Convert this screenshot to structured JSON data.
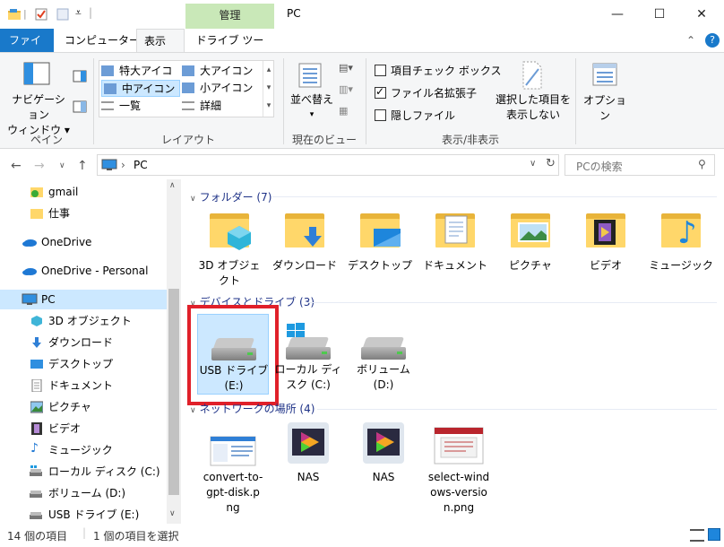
{
  "window": {
    "title": "PC",
    "context_tab_group": "管理",
    "minimize": "—",
    "maximize": "☐",
    "close": "✕"
  },
  "tabs": {
    "file": "ファイル",
    "computer": "コンピューター",
    "view": "表示",
    "drive_tools": "ドライブ ツール"
  },
  "ribbon": {
    "pane": {
      "nav_pane_line1": "ナビゲーション",
      "nav_pane_line2": "ウィンドウ",
      "group_label": "ペイン"
    },
    "layout": {
      "extra_large": "特大アイコン",
      "large": "大アイコン",
      "medium": "中アイコン",
      "small": "小アイコン",
      "list": "一覧",
      "details": "詳細",
      "group_label": "レイアウト"
    },
    "current_view": {
      "sort_line1": "並べ替え",
      "group_label": "現在のビュー"
    },
    "show_hide": {
      "item_checkboxes": "項目チェック ボックス",
      "item_checkboxes_checked": false,
      "file_extensions": "ファイル名拡張子",
      "file_extensions_checked": true,
      "hidden_items": "隠しファイル",
      "hidden_items_checked": false,
      "hide_selected_line1": "選択した項目を",
      "hide_selected_line2": "表示しない",
      "group_label": "表示/非表示"
    },
    "options": {
      "label": "オプション"
    }
  },
  "address": {
    "breadcrumb": "PC",
    "search_placeholder": "PCの検索"
  },
  "nav_pane": {
    "items": [
      {
        "label": "gmail",
        "icon": "folder-check-icon"
      },
      {
        "label": "仕事",
        "icon": "folder-icon"
      },
      {
        "label": "OneDrive",
        "icon": "cloud-icon"
      },
      {
        "label": "OneDrive - Personal",
        "icon": "cloud-icon"
      },
      {
        "label": "PC",
        "icon": "pc-icon",
        "selected": true
      },
      {
        "label": "3D オブジェクト",
        "icon": "3d-objects-icon"
      },
      {
        "label": "ダウンロード",
        "icon": "download-icon"
      },
      {
        "label": "デスクトップ",
        "icon": "desktop-icon"
      },
      {
        "label": "ドキュメント",
        "icon": "document-icon"
      },
      {
        "label": "ピクチャ",
        "icon": "pictures-icon"
      },
      {
        "label": "ビデオ",
        "icon": "video-icon"
      },
      {
        "label": "ミュージック",
        "icon": "music-icon"
      },
      {
        "label": "ローカル ディスク (C:)",
        "icon": "drive-icon"
      },
      {
        "label": "ボリューム (D:)",
        "icon": "drive-icon"
      },
      {
        "label": "USB ドライブ (E:)",
        "icon": "usb-drive-icon"
      }
    ]
  },
  "content": {
    "folders_header": "フォルダー (7)",
    "folders": [
      {
        "label": "3D オブジェクト",
        "icon": "3d-objects-icon"
      },
      {
        "label": "ダウンロード",
        "icon": "download-icon"
      },
      {
        "label": "デスクトップ",
        "icon": "desktop-icon"
      },
      {
        "label": "ドキュメント",
        "icon": "document-icon"
      },
      {
        "label": "ピクチャ",
        "icon": "pictures-icon"
      },
      {
        "label": "ビデオ",
        "icon": "video-icon"
      },
      {
        "label": "ミュージック",
        "icon": "music-icon"
      }
    ],
    "devices_header": "デバイスとドライブ (3)",
    "drives": [
      {
        "line1": "USB ドライブ",
        "line2": "(E:)",
        "selected": true
      },
      {
        "line1": "ローカル ディ",
        "line2": "スク (C:)",
        "selected": false
      },
      {
        "line1": "ボリューム",
        "line2": "(D:)",
        "selected": false
      }
    ],
    "network_header": "ネットワークの場所 (4)",
    "network": [
      {
        "lines": [
          "convert-to-",
          "gpt-disk.p",
          "ng"
        ],
        "icon": "image-thumbnail-icon"
      },
      {
        "lines": [
          "NAS"
        ],
        "icon": "nas-icon"
      },
      {
        "lines": [
          "NAS"
        ],
        "icon": "nas-icon"
      },
      {
        "lines": [
          "select-wind",
          "ows-versio",
          "n.png"
        ],
        "icon": "image-thumbnail-icon"
      }
    ]
  },
  "status": {
    "item_count": "14 個の項目",
    "selected_count": "1 個の項目を選択"
  },
  "colors": {
    "selection_bg": "#cce8ff",
    "highlight_box": "#e0202a",
    "file_tab": "#1979ca",
    "context_tab": "#c9e8b8",
    "section_header": "#1e3287"
  }
}
